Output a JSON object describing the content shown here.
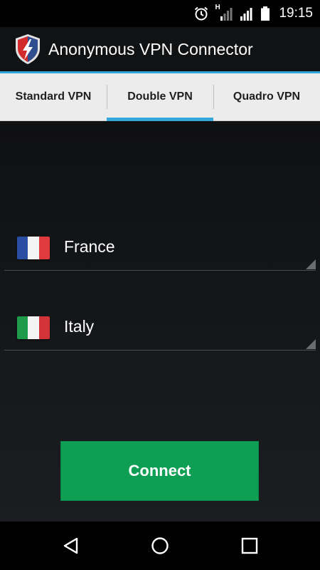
{
  "status_bar": {
    "time": "19:15",
    "network_label": "H",
    "icons": [
      "alarm-icon",
      "signal-icon",
      "battery-icon"
    ]
  },
  "app": {
    "title": "Anonymous VPN Connector",
    "accent_color": "#2ea5d8"
  },
  "tabs": [
    {
      "label": "Standard VPN",
      "active": false
    },
    {
      "label": "Double VPN",
      "active": true
    },
    {
      "label": "Quadro VPN",
      "active": false
    }
  ],
  "countries": [
    {
      "name": "France",
      "flag": "france-flag-icon"
    },
    {
      "name": "Italy",
      "flag": "italy-flag-icon"
    }
  ],
  "connect_button": {
    "label": "Connect",
    "color": "#0e9f54"
  },
  "nav_bar": {
    "buttons": [
      "back-icon",
      "home-icon",
      "recents-icon"
    ]
  }
}
